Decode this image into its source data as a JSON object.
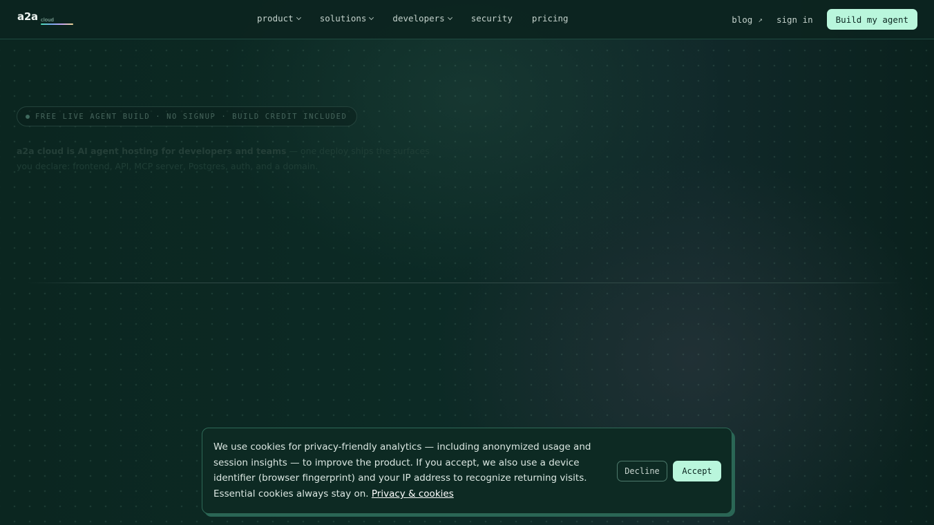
{
  "colors": {
    "accent": "#b9f6dc",
    "background": "#0b2620",
    "border": "#1f4b41"
  },
  "nav": {
    "logo_main": "a2a",
    "logo_sub": "cloud",
    "items": [
      {
        "label": "product",
        "has_dropdown": true
      },
      {
        "label": "solutions",
        "has_dropdown": true
      },
      {
        "label": "developers",
        "has_dropdown": true
      },
      {
        "label": "security",
        "has_dropdown": false
      },
      {
        "label": "pricing",
        "has_dropdown": false
      }
    ],
    "blog_label": "blog",
    "blog_icon": "external-arrow-icon",
    "signin_label": "sign in",
    "cta_label": "Build my agent"
  },
  "hero": {
    "badge_text": "FREE LIVE AGENT BUILD · NO SIGNUP · BUILD CREDIT INCLUDED",
    "desc_strong": "a2a cloud is AI agent hosting for developers and teams",
    "desc_rest": " — one deploy ships the surfaces you declare: frontend, API, MCP server, Postgres, auth, and a domain."
  },
  "cookie": {
    "text": "We use cookies for privacy-friendly analytics — including anonymized usage and session insights — to improve the product. If you accept, we also use a device identifier (browser fingerprint) and your IP address to recognize returning visits. Essential cookies always stay on. ",
    "link_label": "Privacy & cookies",
    "decline_label": "Decline",
    "accept_label": "Accept"
  }
}
